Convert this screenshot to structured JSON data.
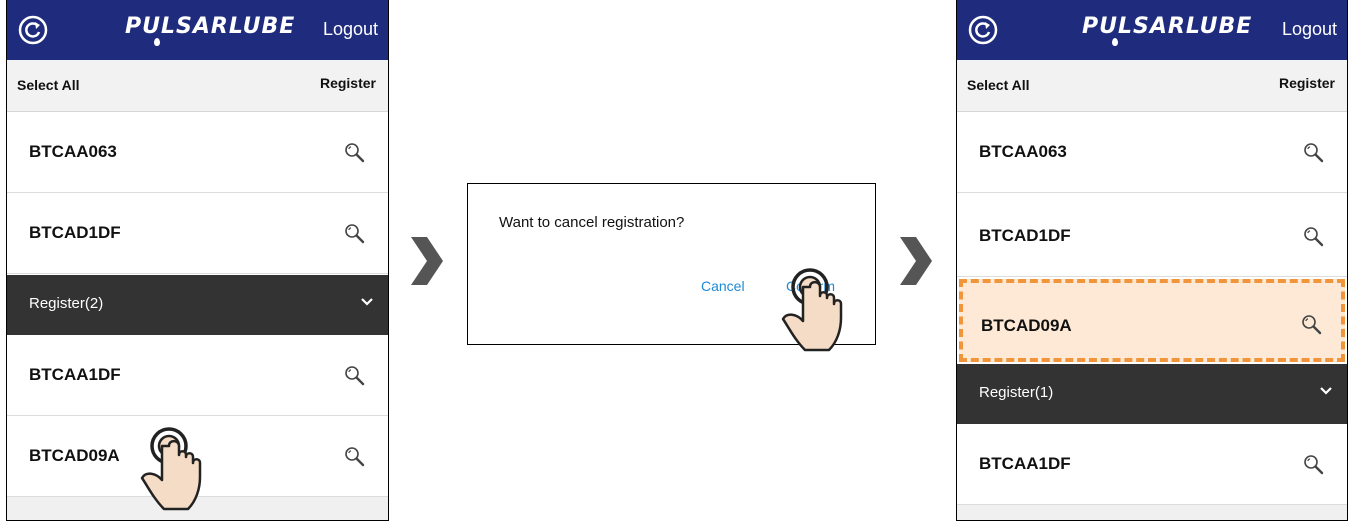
{
  "app": {
    "logo": "PULSARLUBE",
    "logout": "Logout"
  },
  "toolbar": {
    "select_all": "Select All",
    "register": "Register"
  },
  "left_screen": {
    "unregistered": [
      "BTCAA063",
      "BTCAD1DF"
    ],
    "section_label": "Register(2)",
    "registered": [
      "BTCAA1DF",
      "BTCAD09A"
    ]
  },
  "dialog": {
    "message": "Want to cancel registration?",
    "cancel": "Cancel",
    "confirm": "Confirm"
  },
  "right_screen": {
    "unregistered": [
      "BTCAA063",
      "BTCAD1DF",
      "BTCAD09A"
    ],
    "section_label": "Register(1)",
    "registered": [
      "BTCAA1DF"
    ]
  },
  "colors": {
    "header": "#1f2c7e",
    "section": "#333333",
    "dialog_button": "#1f8ad6",
    "highlight_border": "#f0953a",
    "highlight_fill": "#fde9d6"
  },
  "icons": [
    "refresh-icon",
    "magnifier-icon",
    "chevron-down-icon",
    "chevron-right-icon",
    "pointing-hand-icon"
  ]
}
